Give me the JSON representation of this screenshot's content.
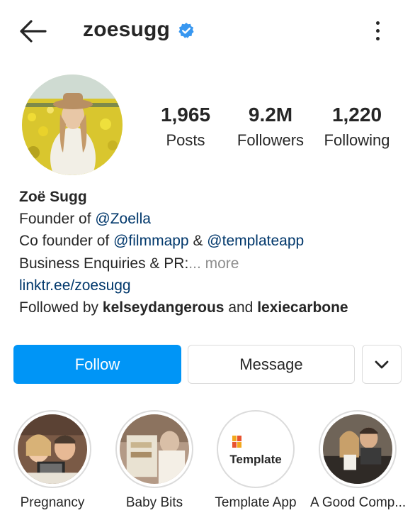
{
  "header": {
    "username": "zoesugg",
    "verified_icon": "verified-badge-icon",
    "back_icon": "arrow-left-icon",
    "menu_icon": "vertical-ellipsis-icon"
  },
  "stats": {
    "posts": {
      "value": "1,965",
      "label": "Posts"
    },
    "followers": {
      "value": "9.2M",
      "label": "Followers"
    },
    "following": {
      "value": "1,220",
      "label": "Following"
    }
  },
  "bio": {
    "name": "Zoë Sugg",
    "line1_prefix": "Founder of ",
    "line1_mention": "@Zoella",
    "line2_prefix": "Co founder of ",
    "line2_mention1": "@filmmapp",
    "line2_amp": " & ",
    "line2_mention2": "@templateapp",
    "line3_text": "Business Enquiries & PR:",
    "line3_more": "... more",
    "link": "linktr.ee/zoesugg",
    "followed_prefix": "Followed by ",
    "followed_user1": "kelseydangerous",
    "followed_and": " and ",
    "followed_user2": "lexiecarbone"
  },
  "actions": {
    "follow_label": "Follow",
    "message_label": "Message",
    "dropdown_icon": "chevron-down-icon"
  },
  "highlights": [
    {
      "label": "Pregnancy"
    },
    {
      "label": "Baby Bits"
    },
    {
      "label": "Template App",
      "inner_text": "Template"
    },
    {
      "label": "A Good Comp..."
    }
  ],
  "colors": {
    "primary_blue": "#0095f6",
    "link_blue": "#00376b",
    "text": "#262626",
    "muted": "#8e8e8e",
    "border": "#dbdbdb"
  }
}
